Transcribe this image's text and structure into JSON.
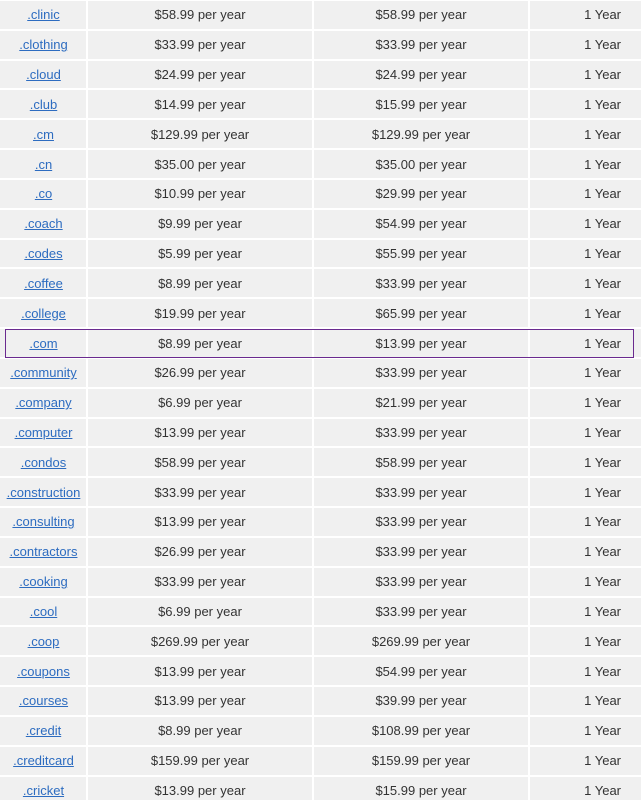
{
  "pricing_table": {
    "rows": [
      {
        "tld": ".clinic",
        "registration": "$58.99 per year",
        "renewal": "$58.99 per year",
        "term": "1 Year"
      },
      {
        "tld": ".clothing",
        "registration": "$33.99 per year",
        "renewal": "$33.99 per year",
        "term": "1 Year"
      },
      {
        "tld": ".cloud",
        "registration": "$24.99 per year",
        "renewal": "$24.99 per year",
        "term": "1 Year"
      },
      {
        "tld": ".club",
        "registration": "$14.99 per year",
        "renewal": "$15.99 per year",
        "term": "1 Year"
      },
      {
        "tld": ".cm",
        "registration": "$129.99 per year",
        "renewal": "$129.99 per year",
        "term": "1 Year"
      },
      {
        "tld": ".cn",
        "registration": "$35.00 per year",
        "renewal": "$35.00 per year",
        "term": "1 Year"
      },
      {
        "tld": ".co",
        "registration": "$10.99 per year",
        "renewal": "$29.99 per year",
        "term": "1 Year"
      },
      {
        "tld": ".coach",
        "registration": "$9.99 per year",
        "renewal": "$54.99 per year",
        "term": "1 Year"
      },
      {
        "tld": ".codes",
        "registration": "$5.99 per year",
        "renewal": "$55.99 per year",
        "term": "1 Year"
      },
      {
        "tld": ".coffee",
        "registration": "$8.99 per year",
        "renewal": "$33.99 per year",
        "term": "1 Year"
      },
      {
        "tld": ".college",
        "registration": "$19.99 per year",
        "renewal": "$65.99 per year",
        "term": "1 Year"
      },
      {
        "tld": ".com",
        "registration": "$8.99 per year",
        "renewal": "$13.99 per year",
        "term": "1 Year",
        "highlighted": true
      },
      {
        "tld": ".community",
        "registration": "$26.99 per year",
        "renewal": "$33.99 per year",
        "term": "1 Year"
      },
      {
        "tld": ".company",
        "registration": "$6.99 per year",
        "renewal": "$21.99 per year",
        "term": "1 Year"
      },
      {
        "tld": ".computer",
        "registration": "$13.99 per year",
        "renewal": "$33.99 per year",
        "term": "1 Year"
      },
      {
        "tld": ".condos",
        "registration": "$58.99 per year",
        "renewal": "$58.99 per year",
        "term": "1 Year"
      },
      {
        "tld": ".construction",
        "registration": "$33.99 per year",
        "renewal": "$33.99 per year",
        "term": "1 Year"
      },
      {
        "tld": ".consulting",
        "registration": "$13.99 per year",
        "renewal": "$33.99 per year",
        "term": "1 Year"
      },
      {
        "tld": ".contractors",
        "registration": "$26.99 per year",
        "renewal": "$33.99 per year",
        "term": "1 Year"
      },
      {
        "tld": ".cooking",
        "registration": "$33.99 per year",
        "renewal": "$33.99 per year",
        "term": "1 Year"
      },
      {
        "tld": ".cool",
        "registration": "$6.99 per year",
        "renewal": "$33.99 per year",
        "term": "1 Year"
      },
      {
        "tld": ".coop",
        "registration": "$269.99 per year",
        "renewal": "$269.99 per year",
        "term": "1 Year"
      },
      {
        "tld": ".coupons",
        "registration": "$13.99 per year",
        "renewal": "$54.99 per year",
        "term": "1 Year"
      },
      {
        "tld": ".courses",
        "registration": "$13.99 per year",
        "renewal": "$39.99 per year",
        "term": "1 Year"
      },
      {
        "tld": ".credit",
        "registration": "$8.99 per year",
        "renewal": "$108.99 per year",
        "term": "1 Year"
      },
      {
        "tld": ".creditcard",
        "registration": "$159.99 per year",
        "renewal": "$159.99 per year",
        "term": "1 Year"
      },
      {
        "tld": ".cricket",
        "registration": "$13.99 per year",
        "renewal": "$15.99 per year",
        "term": "1 Year"
      }
    ]
  },
  "colors": {
    "row_background": "#f0f0f0",
    "link": "#2d6cc0",
    "text": "#333333",
    "highlight_border": "#6a2a8f"
  }
}
